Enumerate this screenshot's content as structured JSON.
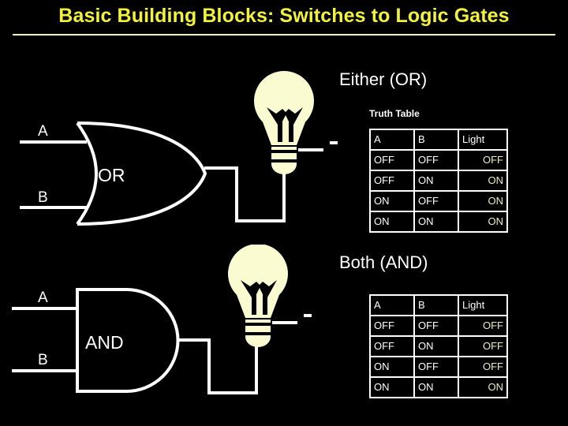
{
  "slide": {
    "title": "Basic Building Blocks: Switches to Logic Gates",
    "background_color": "#000000",
    "title_color": "#f2f23c",
    "rule_color": "#f4f4b8"
  },
  "sections": [
    {
      "id": "or",
      "heading": "Either (OR)",
      "gate_label": "OR",
      "input_a_label": "A",
      "input_b_label": "B",
      "truth_table_label": "Truth Table",
      "table": {
        "headers": [
          "A",
          "B",
          "Light"
        ],
        "rows": [
          [
            "OFF",
            "OFF",
            "OFF"
          ],
          [
            "OFF",
            "ON",
            "ON"
          ],
          [
            "ON",
            "OFF",
            "ON"
          ],
          [
            "ON",
            "ON",
            "ON"
          ]
        ]
      }
    },
    {
      "id": "and",
      "heading": "Both (AND)",
      "gate_label": "AND",
      "input_a_label": "A",
      "input_b_label": "B",
      "truth_table_label": "",
      "table": {
        "headers": [
          "A",
          "B",
          "Light"
        ],
        "rows": [
          [
            "OFF",
            "OFF",
            "OFF"
          ],
          [
            "OFF",
            "ON",
            "OFF"
          ],
          [
            "ON",
            "OFF",
            "OFF"
          ],
          [
            "ON",
            "ON",
            "ON"
          ]
        ]
      }
    }
  ],
  "icons": {
    "lightbulb": "lightbulb-icon",
    "or_gate": "or-gate-icon",
    "and_gate": "and-gate-icon"
  },
  "colors": {
    "wire": "#ffffff",
    "bulb_glass": "#fbfbd2",
    "light_column_text": "#efeec0"
  }
}
